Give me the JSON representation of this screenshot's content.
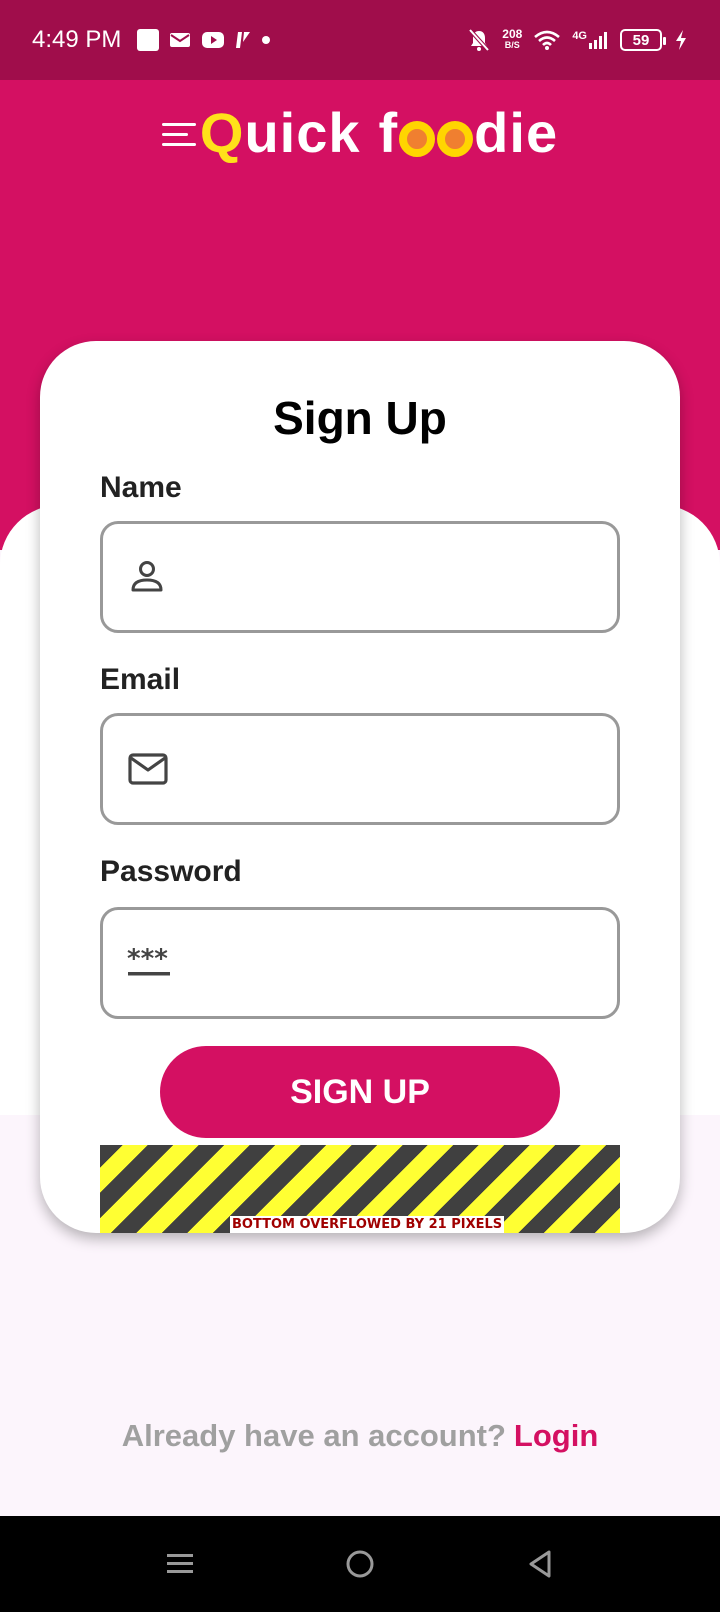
{
  "status": {
    "time": "4:49 PM",
    "net_speed_value": "208",
    "net_speed_unit": "B/S",
    "network": "4G",
    "battery": "59"
  },
  "header": {
    "logo_left": "uick",
    "logo_q": "Q",
    "logo_f": "f",
    "logo_right": "die",
    "brand_color": "#d41062",
    "status_bar_color": "#a00d4b"
  },
  "form": {
    "title": "Sign Up",
    "name_label": "Name",
    "name_value": "",
    "email_label": "Email",
    "email_value": "",
    "password_label": "Password",
    "password_value": "",
    "submit_label": "SIGN UP",
    "overflow_message": "BOTTOM OVERFLOWED BY 21 PIXELS"
  },
  "footer": {
    "prompt_text": "Already have an account?",
    "login_label": "Login"
  },
  "icons": {
    "name_field": "person-icon",
    "email_field": "mail-icon",
    "password_field": "password-icon"
  }
}
